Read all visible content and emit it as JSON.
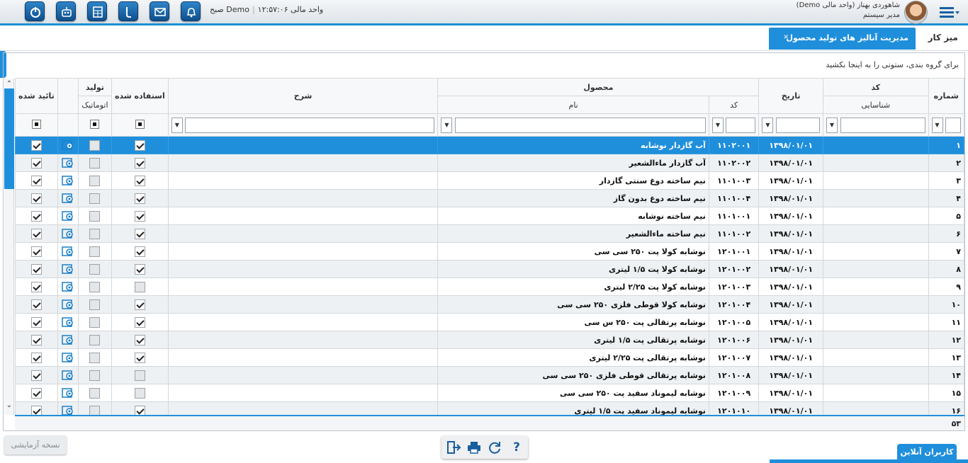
{
  "header": {
    "unit_label": "واحد مالی Demo",
    "time": "۱۲:۵۷:۰۶ صبح",
    "user_name": "شاهوردی بهناز (واحد مالی Demo)",
    "user_role": "مدیر سیستم",
    "toolbar_icons": [
      "power-icon",
      "robot-icon",
      "calculator-icon",
      "phone-icon",
      "mail-icon",
      "bell-icon"
    ]
  },
  "tabs": {
    "home": "میز کار",
    "active": "مدیریت آنالیز های تولید محصول",
    "close": "×"
  },
  "grid": {
    "group_hint": "برای گروه بندی، ستونی را به اینجا بکشید",
    "headers": {
      "row_no": "شماره",
      "id_code_top": "کد",
      "id_code_bottom": "شناسایی",
      "date": "تاریخ",
      "product": "محصول",
      "product_code": "کد",
      "product_name": "نام",
      "description": "شرح",
      "used": "استفاده شده",
      "auto_top": "تولید",
      "auto_bottom": "اتوماتیک",
      "approved": "تائید شده"
    },
    "rows": [
      {
        "no": "۱",
        "id": "",
        "date": "۱۳۹۸/۰۱/۰۱",
        "code": "۱۱۰۲۰۰۱",
        "name": "آب گازدار نوشابه",
        "desc": "",
        "used": true,
        "auto": false,
        "approved": true
      },
      {
        "no": "۲",
        "id": "",
        "date": "۱۳۹۸/۰۱/۰۱",
        "code": "۱۱۰۲۰۰۲",
        "name": "آب گازدار ماءالشعیر",
        "desc": "",
        "used": true,
        "auto": false,
        "approved": true
      },
      {
        "no": "۳",
        "id": "",
        "date": "۱۳۹۸/۰۱/۰۱",
        "code": "۱۱۰۱۰۰۳",
        "name": "نیم ساخته دوغ سنتی گازدار",
        "desc": "",
        "used": true,
        "auto": false,
        "approved": true
      },
      {
        "no": "۴",
        "id": "",
        "date": "۱۳۹۸/۰۱/۰۱",
        "code": "۱۱۰۱۰۰۴",
        "name": "نیم ساخته دوغ بدون گاز",
        "desc": "",
        "used": true,
        "auto": false,
        "approved": true
      },
      {
        "no": "۵",
        "id": "",
        "date": "۱۳۹۸/۰۱/۰۱",
        "code": "۱۱۰۱۰۰۱",
        "name": "نیم ساخته نوشابه",
        "desc": "",
        "used": true,
        "auto": false,
        "approved": true
      },
      {
        "no": "۶",
        "id": "",
        "date": "۱۳۹۸/۰۱/۰۱",
        "code": "۱۱۰۱۰۰۲",
        "name": "نیم ساخته ماءالشعیر",
        "desc": "",
        "used": true,
        "auto": false,
        "approved": true
      },
      {
        "no": "۷",
        "id": "",
        "date": "۱۳۹۸/۰۱/۰۱",
        "code": "۱۲۰۱۰۰۱",
        "name": "نوشابه کولا پت ۲۵۰ سی سی",
        "desc": "",
        "used": true,
        "auto": false,
        "approved": true
      },
      {
        "no": "۸",
        "id": "",
        "date": "۱۳۹۸/۰۱/۰۱",
        "code": "۱۲۰۱۰۰۲",
        "name": "نوشابه کولا پت ۱/۵ لیتری",
        "desc": "",
        "used": true,
        "auto": false,
        "approved": true
      },
      {
        "no": "۹",
        "id": "",
        "date": "۱۳۹۸/۰۱/۰۱",
        "code": "۱۲۰۱۰۰۳",
        "name": "نوشابه کولا پت ۲/۲۵ لیتری",
        "desc": "",
        "used": false,
        "auto": false,
        "approved": true
      },
      {
        "no": "۱۰",
        "id": "",
        "date": "۱۳۹۸/۰۱/۰۱",
        "code": "۱۲۰۱۰۰۴",
        "name": "نوشابه کولا قوطی فلزی ۲۵۰ سی سی",
        "desc": "",
        "used": true,
        "auto": false,
        "approved": true
      },
      {
        "no": "۱۱",
        "id": "",
        "date": "۱۳۹۸/۰۱/۰۱",
        "code": "۱۲۰۱۰۰۵",
        "name": "نوشابه پرتقالی پت ۲۵۰ س سی",
        "desc": "",
        "used": true,
        "auto": false,
        "approved": true
      },
      {
        "no": "۱۲",
        "id": "",
        "date": "۱۳۹۸/۰۱/۰۱",
        "code": "۱۲۰۱۰۰۶",
        "name": "نوشابه پرتقالی پت ۱/۵ لیتری",
        "desc": "",
        "used": true,
        "auto": false,
        "approved": true
      },
      {
        "no": "۱۳",
        "id": "",
        "date": "۱۳۹۸/۰۱/۰۱",
        "code": "۱۲۰۱۰۰۷",
        "name": "نوشابه پرتقالی پت ۲/۲۵ لیتری",
        "desc": "",
        "used": true,
        "auto": false,
        "approved": true
      },
      {
        "no": "۱۴",
        "id": "",
        "date": "۱۳۹۸/۰۱/۰۱",
        "code": "۱۲۰۱۰۰۸",
        "name": "نوشابه پرتقالی قوطی فلزی ۲۵۰ سی سی",
        "desc": "",
        "used": false,
        "auto": false,
        "approved": true
      },
      {
        "no": "۱۵",
        "id": "",
        "date": "۱۳۹۸/۰۱/۰۱",
        "code": "۱۲۰۱۰۰۹",
        "name": "نوشابه لیموناد سفید پت ۲۵۰ سی سی",
        "desc": "",
        "used": false,
        "auto": false,
        "approved": true
      },
      {
        "no": "۱۶",
        "id": "",
        "date": "۱۳۹۸/۰۱/۰۱",
        "code": "۱۲۰۱۰۱۰",
        "name": "نوشابه لیموناد سفید پت ۱/۵ لیتری",
        "desc": "",
        "used": true,
        "auto": false,
        "approved": true
      }
    ],
    "total_count": "۵۳",
    "selected_row": 0
  },
  "footer": {
    "trial_label": "نسخه آزمایشی",
    "online_users": "کاربران آنلاین",
    "tools": [
      "exit-icon",
      "print-icon",
      "refresh-icon",
      "help-icon"
    ],
    "help_glyph": "?"
  },
  "colors": {
    "accent": "#1f8fdc",
    "toolbar": "#1a5f9e"
  }
}
